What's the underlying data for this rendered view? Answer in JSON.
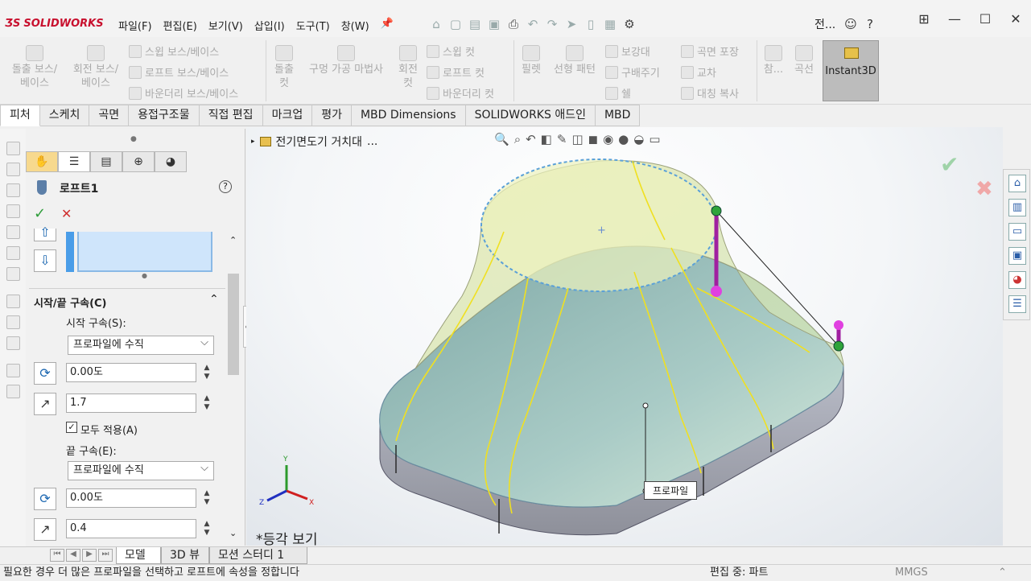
{
  "app": {
    "logo_text": "SOLIDWORKS",
    "document_name": "전..."
  },
  "menu": [
    "파일(F)",
    "편집(E)",
    "보기(V)",
    "삽입(I)",
    "도구(T)",
    "창(W)"
  ],
  "ribbon": {
    "boss_extrude": "돌출 보스/\n베이스",
    "boss_revolve": "회전 보스/\n베이스",
    "sweep_boss": "스윕 보스/베이스",
    "loft_boss": "로프트 보스/베이스",
    "boundary_boss": "바운더리 보스/베이스",
    "extruded_cut": "돌출\n컷",
    "hole_wizard": "구멍 가공 마법사",
    "revolved_cut": "회전\n컷",
    "swept_cut": "스윕 컷",
    "lofted_cut": "로프트 컷",
    "boundary_cut": "바운더리 컷",
    "fillet": "필렛",
    "linear_pattern": "선형 패턴",
    "rib": "보강대",
    "draft": "구배주기",
    "shell": "쉘",
    "wrap": "곡면 포장",
    "intersect": "교차",
    "mirror": "대칭 복사",
    "reference": "참...",
    "curves": "곡선",
    "instant3d": "Instant3D"
  },
  "tabs": [
    "피처",
    "스케치",
    "곡면",
    "용접구조물",
    "직접 편집",
    "마크업",
    "평가",
    "MBD Dimensions",
    "SOLIDWORKS 애드인",
    "MBD"
  ],
  "property_manager": {
    "title": "로프트1",
    "section_title": "시작/끝 구속(C)",
    "start_label": "시작 구속(S):",
    "start_value": "프로파일에 수직",
    "start_angle": "0.00도",
    "start_length": "1.7",
    "apply_all": "모두 적용(A)",
    "end_label": "끝 구속(E):",
    "end_value": "프로파일에 수직",
    "end_angle": "0.00도",
    "end_length": "0.4"
  },
  "viewport": {
    "feature_tree_item": "전기면도기 거치대",
    "view_label": "*등각 보기",
    "callout_label": "프로파일",
    "axis_labels": {
      "x": "X",
      "y": "Y",
      "z": "Z"
    }
  },
  "bottom_tabs": [
    "모델",
    "3D 뷰",
    "모션 스터디 1"
  ],
  "status": {
    "message": "필요한 경우 더 많은 프로파일을 선택하고 로프트에 속성을 정합니다",
    "mode": "편집 중: 파트",
    "units": "MMGS"
  },
  "colors": {
    "accent": "#c8102e",
    "confirm": "#2e9d3a",
    "cancel": "#d03030",
    "guide": "#a020a0"
  }
}
